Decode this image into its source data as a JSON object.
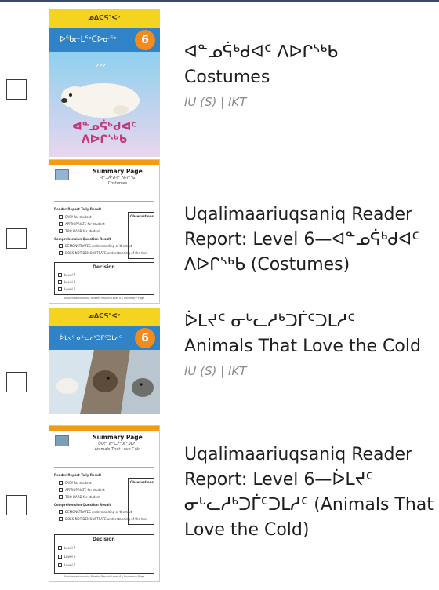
{
  "items": [
    {
      "title": "ᐊᓐᓄᕌᒃᑯᐊᑦ ᐱᐅᒋᔅᒃᑲ",
      "subtitle": "Costumes",
      "meta": "IU (S) | IKT",
      "cover": {
        "top_label": "ᓄᐃᑕᕋᕐᐸᒃ",
        "band_label": "ᐅᖃᓕᒫᖅᑕᐅᓂᖅ",
        "level": "6",
        "caption": "ᐊᓐᓄᕌᒃᑯᐊᑦ ᐱᐅᒋᔅᒃᑲ",
        "colors": {
          "band": "#2f83c6",
          "bg": "#f4d321",
          "accent": "#f28b1d",
          "caption": "#c2387a"
        }
      }
    },
    {
      "title": "Uqalimaariuqsaniq Reader Report: Level 6—ᐊᓐᓄᕌᒃᑯᐊᑦ ᐱᐅᒋᔅᒃᑲ  (Costumes)",
      "sheet": {
        "title": "Summary Page",
        "subtitle_native": "ᐊᓐᓄᕌᒃᑯᐊᑦ ᐱᐅᒋᔅᒃᑲ",
        "subtitle": "Costumes",
        "section1": "Reader Report Tally Result",
        "option_easy": "EASY for student",
        "option_appropriate": "APPROPRIATE for student",
        "option_hard": "TOO HARD for student",
        "section2": "Comprehension Question Result",
        "option_demo": "DEMONSTRATES understanding of the text",
        "option_nodemo": "DOES NOT DEMONSTRATE understanding of the text",
        "observations": "Observations",
        "decision": "Decision",
        "level_up": "Level 7",
        "level_same": "Level 6",
        "level_down": "Level 5",
        "footer": "Uqalimaariuqsaniq Reader Report Level 6 | Summary Page"
      }
    },
    {
      "title": "ᐆᒪᔪᑦ ᓂᒡᓚᓱᒃᑐᒦᑦᑐᒪᓱᑦ",
      "subtitle": "Animals That Love the Cold",
      "meta": "IU (S) | IKT",
      "cover": {
        "top_label": "ᓄᐃᑕᕋᕐᐸᒃ",
        "band_label": "ᐆᒪᔪᑦ ᓂᒡᓚᓱᒃᑐᒦᑦᑐᒪᓱᑦ",
        "level": "6",
        "colors": {
          "band": "#2f83c6",
          "bg": "#f4d321",
          "accent": "#f28b1d"
        }
      }
    },
    {
      "title": "Uqalimaariuqsaniq Reader Report: Level 6—ᐆᒪᔪᑦ ᓂᒡᓚᓱᒃᑐᒦᑦᑐᒪᓱᑦ (Animals That Love the Cold)",
      "sheet": {
        "title": "Summary Page",
        "subtitle_native": "ᐆᒪᔪᑦ ᓂᒡᓚᓱᒃᑐᒦᑦᑐᒪᓱᑦ",
        "subtitle": "Animals That Love Cold",
        "section1": "Reader Report Tally Result",
        "option_easy": "EASY for student",
        "option_appropriate": "APPROPRIATE for student",
        "option_hard": "TOO HARD for student",
        "section2": "Comprehension Question Result",
        "option_demo": "DEMONSTRATES understanding of the text",
        "option_nodemo": "DOES NOT DEMONSTRATE understanding of the text",
        "observations": "Observations",
        "decision": "Decision",
        "level_up": "Level 7",
        "level_same": "Level 6",
        "level_down": "Level 5",
        "footer": "Uqalimaariuqsaniq Reader Report Level 6 | Summary Page"
      }
    }
  ]
}
